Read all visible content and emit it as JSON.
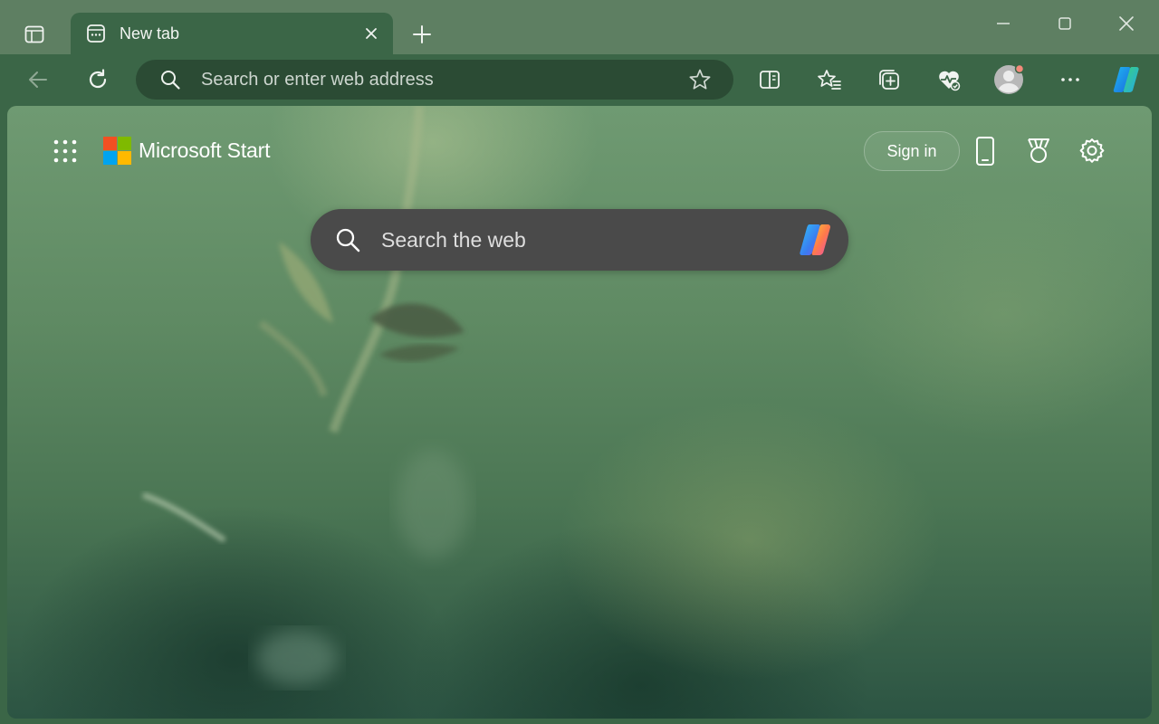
{
  "tabstrip": {
    "tab": {
      "title": "New tab"
    },
    "icons": {
      "tab_actions": "sidebar-panel-icon",
      "favicon": "new-tab-page-icon",
      "close": "close-icon",
      "new_tab": "plus-icon",
      "minimize": "minimize-icon",
      "maximize": "maximize-icon",
      "window_close": "close-icon"
    }
  },
  "toolbar": {
    "address_placeholder": "Search or enter web address",
    "icons": [
      "back-arrow-icon",
      "refresh-icon",
      "search-icon",
      "star-icon",
      "split-screen-icon",
      "favorites-icon",
      "collections-icon",
      "browser-essentials-icon",
      "profile-avatar-icon",
      "more-icon",
      "copilot-icon"
    ]
  },
  "content": {
    "brand": "Microsoft Start",
    "sign_in": "Sign in",
    "search_placeholder": "Search the web",
    "icons": [
      "app-launcher-icon",
      "microsoft-logo-icon",
      "phone-icon",
      "rewards-icon",
      "settings-icon",
      "search-icon",
      "copilot-icon"
    ]
  },
  "colors": {
    "tabstrip_bg": "#5e7f62",
    "toolbar_bg": "#3b6647",
    "addressbar_bg": "#2b4b34",
    "search_box_bg": "#4a4a4a",
    "ms_red": "#f25022",
    "ms_green": "#7fba00",
    "ms_blue": "#00a4ef",
    "ms_yellow": "#ffb900",
    "profile_badge": "#f48a7a"
  }
}
